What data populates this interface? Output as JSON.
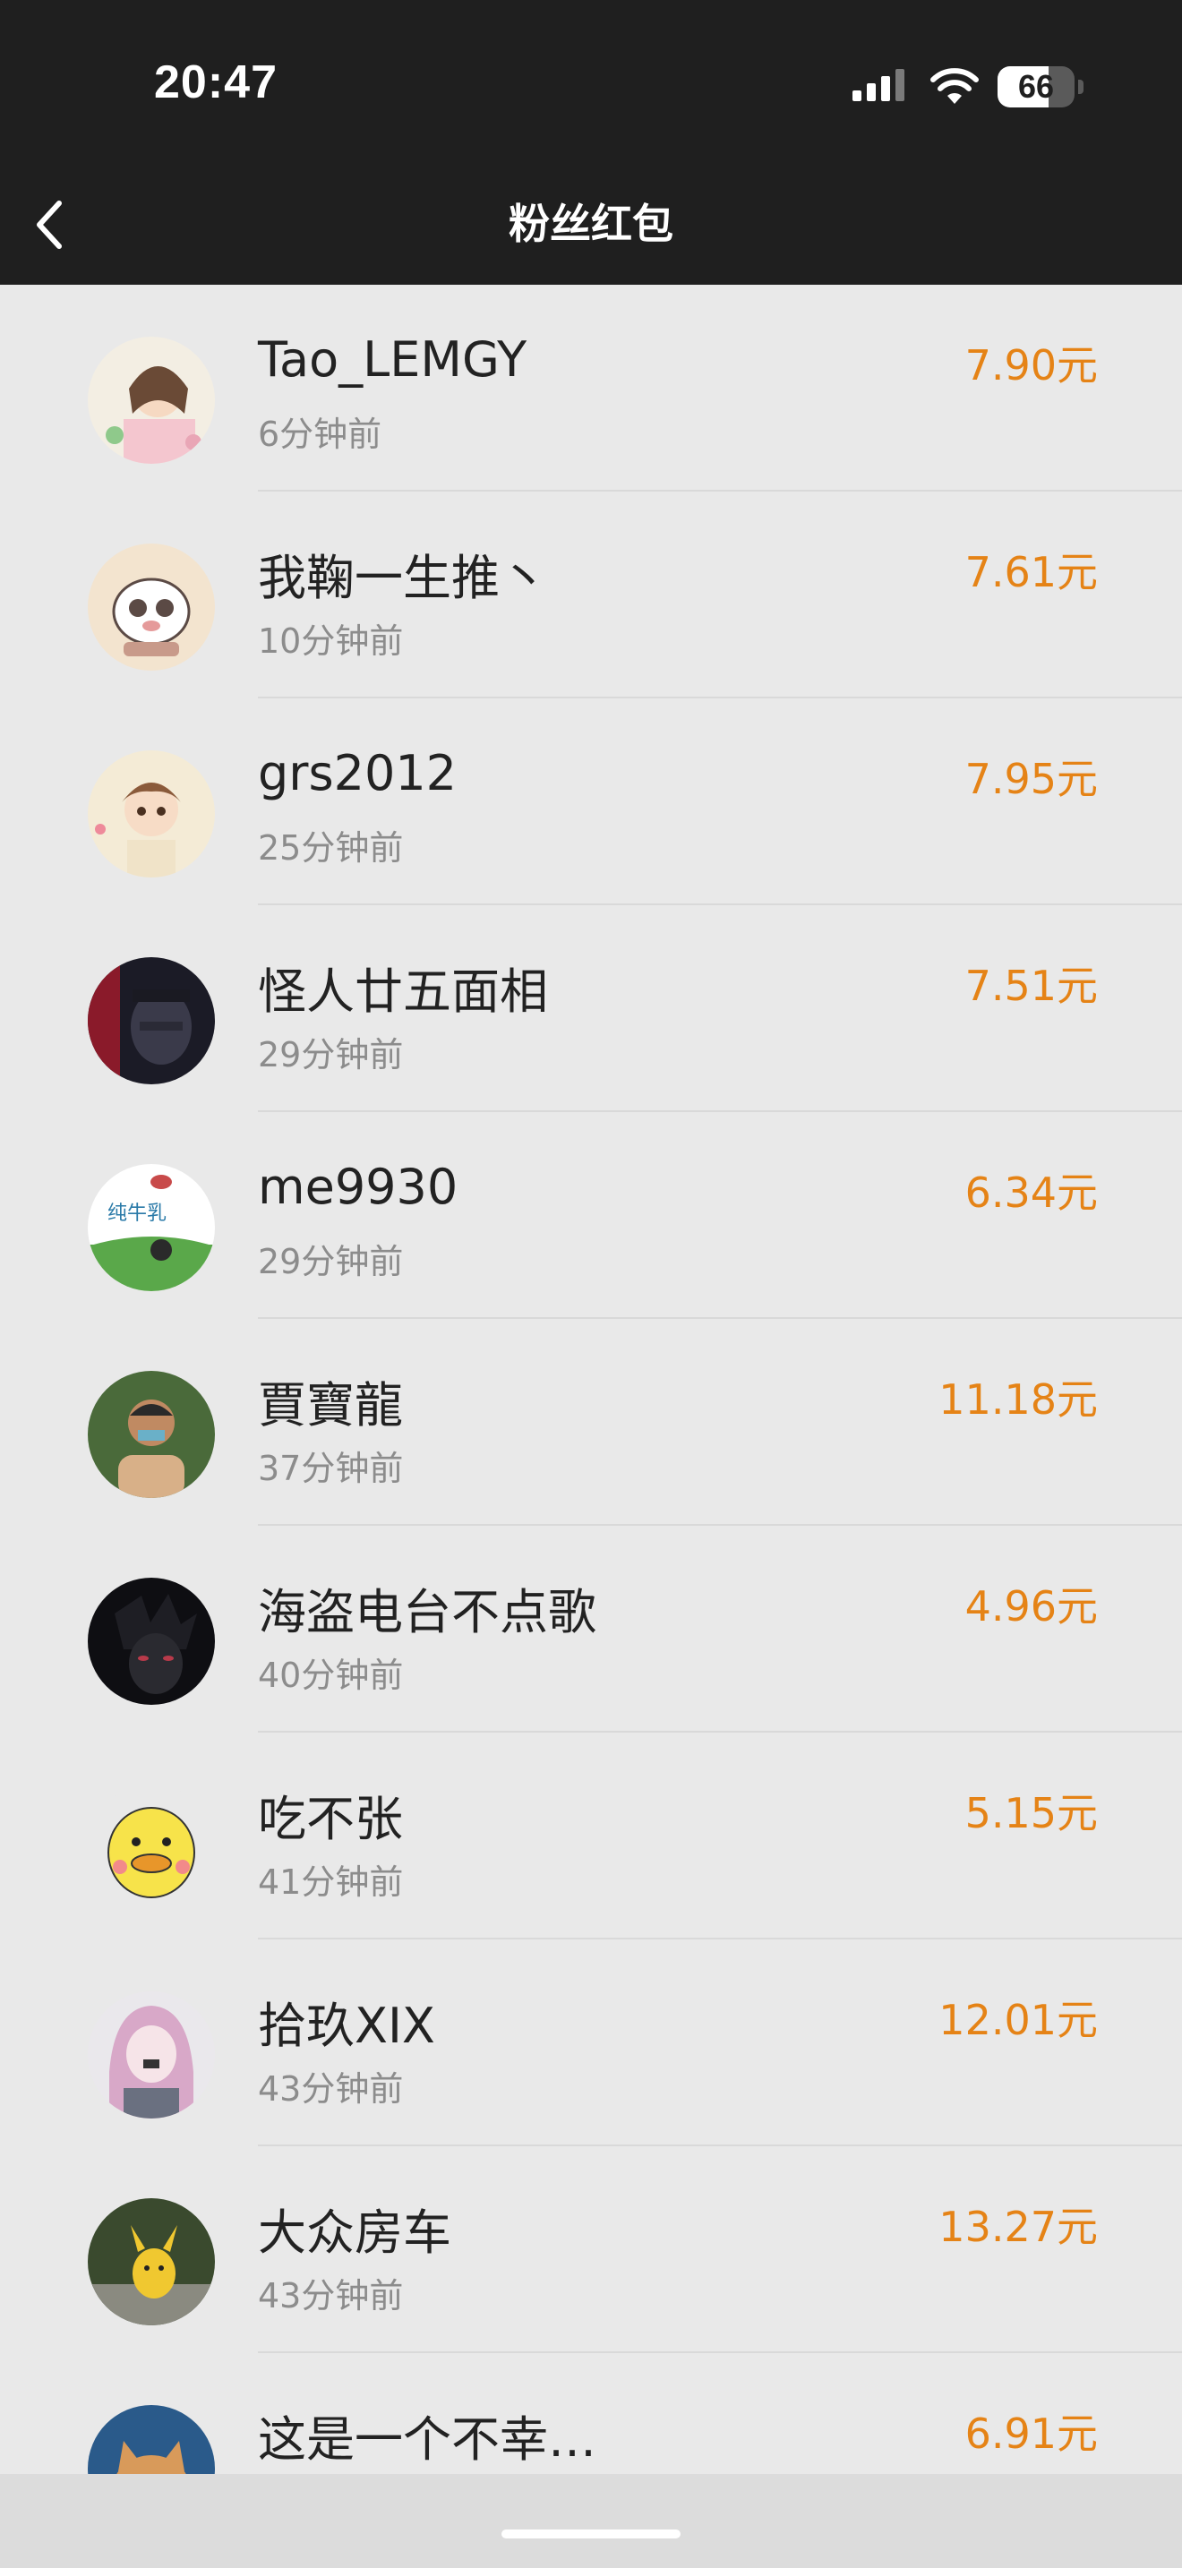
{
  "status_bar": {
    "time": "20:47",
    "battery": "66",
    "battery_level": 0.66
  },
  "nav": {
    "title": "粉丝红包",
    "back_icon": "chevron-left-icon"
  },
  "colors": {
    "header_bg": "#1f1f1f",
    "page_bg": "#e9e9e9",
    "amount": "#e58316",
    "name": "#222222",
    "time": "#8c8c8c",
    "divider": "#d9d9d9"
  },
  "items": [
    {
      "name": "Tao_LEMGY",
      "time": "6分钟前",
      "amount": "7.90元",
      "avatar": "anime-girl-avatar"
    },
    {
      "name": "我鞠一生推丶",
      "time": "10分钟前",
      "amount": "7.61元",
      "avatar": "cartoon-cat-avatar"
    },
    {
      "name": "grs2012",
      "time": "25分钟前",
      "amount": "7.95元",
      "avatar": "anime-boy-avatar"
    },
    {
      "name": "怪人廿五面相",
      "time": "29分钟前",
      "amount": "7.51元",
      "avatar": "dark-mask-avatar"
    },
    {
      "name": "me9930",
      "time": "29分钟前",
      "amount": "6.34元",
      "avatar": "cow-globe-avatar"
    },
    {
      "name": "賈寶龍",
      "time": "37分钟前",
      "amount": "11.18元",
      "avatar": "man-photo-avatar"
    },
    {
      "name": "海盗电台不点歌",
      "time": "40分钟前",
      "amount": "4.96元",
      "avatar": "dark-anime-avatar"
    },
    {
      "name": "吃不张",
      "time": "41分钟前",
      "amount": "5.15元",
      "avatar": "yellow-duck-avatar"
    },
    {
      "name": "拾玖XIX",
      "time": "43分钟前",
      "amount": "12.01元",
      "avatar": "pink-hair-girl-avatar"
    },
    {
      "name": "大众房车",
      "time": "43分钟前",
      "amount": "13.27元",
      "avatar": "pikachu-avatar"
    },
    {
      "name": "这是一个不幸…",
      "time": "",
      "amount": "6.91元",
      "avatar": "cat-photo-avatar"
    }
  ]
}
